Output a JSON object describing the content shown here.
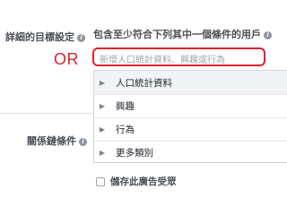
{
  "detailed_targeting": {
    "label": "詳細的目標設定",
    "include_text": "包含至少符合下列其中一個條件的用戶",
    "or_label": "OR",
    "search": {
      "placeholder": "新增人口統計資料、興趣或行為",
      "value": ""
    },
    "options": [
      {
        "label": "人口統計資料",
        "highlighted": true
      },
      {
        "label": "興趣",
        "highlighted": false
      },
      {
        "label": "行為",
        "highlighted": false
      },
      {
        "label": "更多類別",
        "highlighted": false
      }
    ]
  },
  "connections": {
    "label": "關係鏈條件"
  },
  "save_audience": {
    "label": "儲存此廣告受眾",
    "checked": false
  },
  "icons": {
    "info": "info-icon",
    "chevron": "chevron-right-icon"
  }
}
